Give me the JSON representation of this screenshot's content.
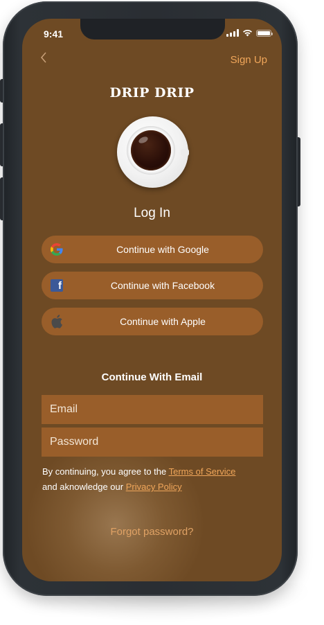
{
  "status_bar": {
    "time": "9:41"
  },
  "header": {
    "back_icon": "chevron-left-icon",
    "signup_label": "Sign Up",
    "brand": "DRIP DRIP"
  },
  "hero_image": "coffee-cup-top-view",
  "login": {
    "heading": "Log In",
    "social": [
      {
        "label": "Continue with Google",
        "icon": "google-icon"
      },
      {
        "label": "Continue with Facebook",
        "icon": "facebook-icon"
      },
      {
        "label": "Continue with Apple",
        "icon": "apple-icon"
      }
    ]
  },
  "email_section": {
    "heading": "Continue With Email",
    "email_placeholder": "Email",
    "password_placeholder": "Password"
  },
  "legal": {
    "prefix": "By continuing, you agree to the ",
    "terms_link": "Terms of Service",
    "middle": "and aknowledge our ",
    "privacy_link": "Privacy Policy"
  },
  "forgot_password": "Forgot password?",
  "colors": {
    "background": "#6e4a24",
    "button": "#995e2a",
    "accent": "#f0a65a"
  }
}
